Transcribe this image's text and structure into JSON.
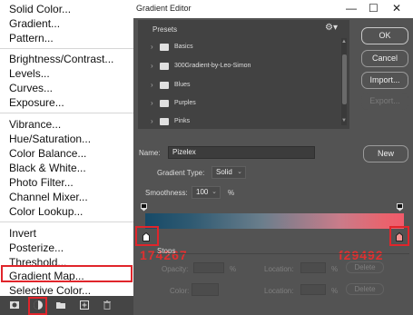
{
  "menu": {
    "items": [
      "Solid Color...",
      "Gradient...",
      "Pattern...",
      "Brightness/Contrast...",
      "Levels...",
      "Curves...",
      "Exposure...",
      "Vibrance...",
      "Hue/Saturation...",
      "Color Balance...",
      "Black & White...",
      "Photo Filter...",
      "Channel Mixer...",
      "Color Lookup...",
      "Invert",
      "Posterize...",
      "Threshold...",
      "Gradient Map...",
      "Selective Color..."
    ]
  },
  "toolbar": {
    "icons": [
      "mask-icon",
      "adjustment-circle-icon",
      "folder-icon",
      "new-layer-icon",
      "trash-icon"
    ]
  },
  "dialog": {
    "title": "Gradient Editor",
    "presets_label": "Presets",
    "presets": [
      "Basics",
      "300Gradient-by-Leo-Simon",
      "Blues",
      "Purples",
      "Pinks"
    ],
    "buttons": {
      "ok": "OK",
      "cancel": "Cancel",
      "import": "Import...",
      "export": "Export...",
      "new": "New"
    },
    "name_label": "Name:",
    "name_value": "Pizelex",
    "gradient_type_label": "Gradient Type:",
    "gradient_type_value": "Solid",
    "smoothness_label": "Smoothness:",
    "smoothness_value": "100",
    "smoothness_unit": "%",
    "stops_label": "Stops",
    "opacity_label": "Opacity:",
    "location_label": "Location:",
    "color_label": "Color:",
    "pct": "%",
    "delete_label": "Delete",
    "left_stop_hex": "174267",
    "right_stop_hex": "f29492",
    "gradient_colors": {
      "start": "#174a67",
      "end": "#f05a6a"
    }
  },
  "accent": {
    "highlight_red": "#e0252b"
  }
}
